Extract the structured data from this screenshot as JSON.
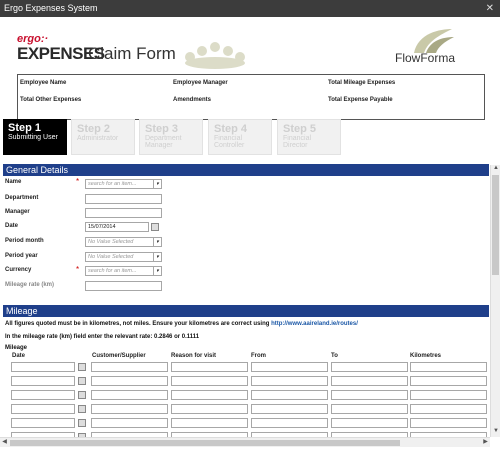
{
  "window": {
    "title": "Ergo Expenses System",
    "close_glyph": "✕"
  },
  "header": {
    "brand": "ergo",
    "brand_suffix": ":·",
    "title_main": "EXPENSES",
    "title_rest": "Claim Form",
    "flowforma": "FlowForma"
  },
  "summary": {
    "employee_name": "Employee Name",
    "employee_manager": "Employee Manager",
    "total_mileage_expenses": "Total Mileage Expenses",
    "total_other_expenses": "Total Other Expenses",
    "amendments": "Amendments",
    "total_expense_payable": "Total Expense Payable"
  },
  "steps": [
    {
      "title": "Step 1",
      "desc": "Submitting User"
    },
    {
      "title": "Step 2",
      "desc": "Administrator"
    },
    {
      "title": "Step 3",
      "desc": "Department Manager"
    },
    {
      "title": "Step 4",
      "desc": "Financial Controller"
    },
    {
      "title": "Step 5",
      "desc": "Financial Director"
    }
  ],
  "general": {
    "heading": "General Details",
    "name_label": "Name",
    "name_placeholder": "search for an item...",
    "department_label": "Department",
    "manager_label": "Manager",
    "date_label": "Date",
    "date_value": "15/07/2014",
    "period_month_label": "Period month",
    "period_month_value": "No Value Selected",
    "period_year_label": "Period year",
    "period_year_value": "No Value Selected",
    "currency_label": "Currency",
    "currency_placeholder": "search for an item...",
    "mileage_rate_label": "Mileage rate (km)",
    "required_mark": "*"
  },
  "mileage": {
    "heading": "Mileage",
    "note1": "All figures quoted must be in kilometres, not miles. Ensure your kilometres are correct using ",
    "note1_link": "http://www.aaireland.ie/routes/",
    "note2": "In the mileage rate (km) field enter the relevant rate: 0.2846 or 0.1111",
    "table_label": "Mileage",
    "columns": [
      "Date",
      "Customer/Supplier",
      "Reason for visit",
      "From",
      "To",
      "Kilometres"
    ]
  },
  "accent_color": "#1f3f8a",
  "icons": [
    "close-icon",
    "dropdown-icon",
    "calendar-icon",
    "people-graphic",
    "flowforma-logo-icon"
  ]
}
